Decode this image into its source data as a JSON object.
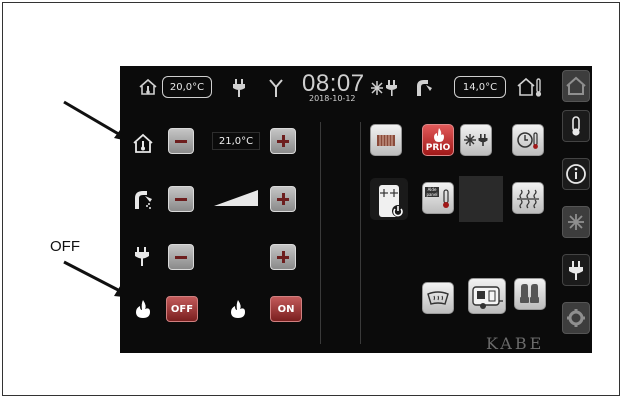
{
  "annotation": {
    "off_label": "OFF"
  },
  "topbar": {
    "indoor_temp": "20,0°C",
    "time": "08:07",
    "date": "2018-10-12",
    "outdoor_temp": "14,0°C"
  },
  "controls": {
    "room_setpoint": "21,0°C",
    "gas_off_label": "OFF",
    "gas_on_label": "ON"
  },
  "tiles": {
    "prio_label": "PRIO",
    "aldeboard_label": "Alde panel"
  },
  "brand": "KABE",
  "icons": {
    "house": "house-thermometer-icon",
    "plug": "electric-plug-icon",
    "antenna": "antenna-icon",
    "snow_plug": "snowflake-plug-icon",
    "shower": "shower-icon",
    "flame": "flame-icon",
    "info": "info-icon",
    "gear": "gear-icon"
  },
  "colors": {
    "accent_red": "#a01818",
    "screen_bg": "#0b0b0b"
  }
}
